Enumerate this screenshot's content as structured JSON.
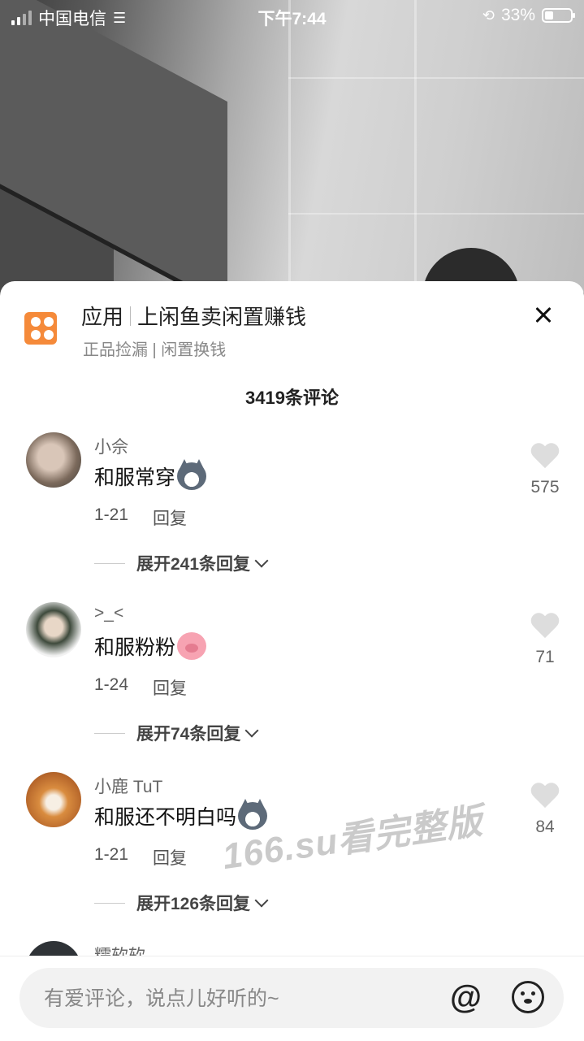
{
  "status_bar": {
    "carrier": "中国电信",
    "time": "下午7:44",
    "battery_percent": "33%",
    "battery_level": 0.33
  },
  "ad": {
    "category": "应用",
    "title": "上闲鱼卖闲置赚钱",
    "subtitle": "正品捡漏 | 闲置换钱",
    "icon_color": "#f58a3a"
  },
  "comments_header": {
    "count_label": "3419条评论"
  },
  "comments": [
    {
      "username": "小佘",
      "text": "和服常穿",
      "emoji": "husky-icon",
      "date": "1-21",
      "reply_label": "回复",
      "expand_label": "展开241条回复",
      "likes": "575"
    },
    {
      "username": ">_<",
      "text": "和服粉粉",
      "emoji": "pig-icon",
      "date": "1-24",
      "reply_label": "回复",
      "expand_label": "展开74条回复",
      "likes": "71"
    },
    {
      "username": "小鹿 TuT",
      "text": "和服还不明白吗",
      "emoji": "husky-icon",
      "date": "1-21",
      "reply_label": "回复",
      "expand_label": "展开126条回复",
      "likes": "84"
    }
  ],
  "partial_comment": {
    "username": "糯软软"
  },
  "watermark": "166.su看完整版",
  "input": {
    "placeholder": "有爱评论，说点儿好听的~",
    "at_symbol": "@"
  }
}
